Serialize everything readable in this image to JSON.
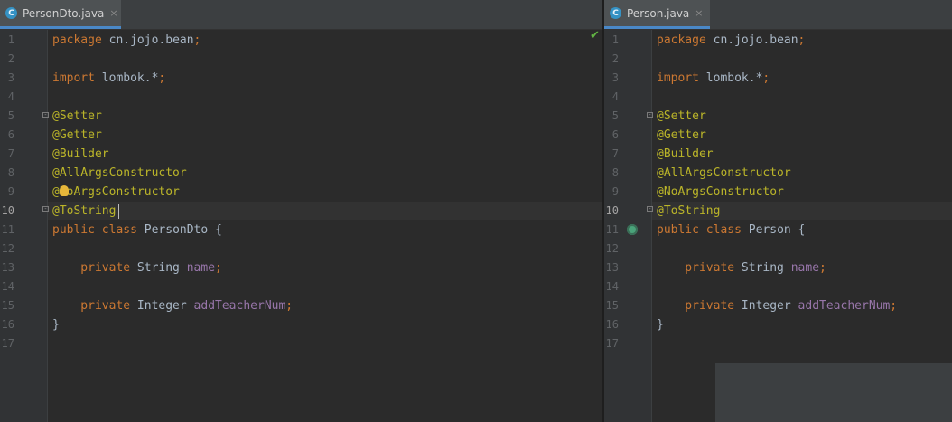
{
  "tabs": {
    "left": {
      "label": "PersonDto.java",
      "icon": "java-class-icon",
      "icon_letter": "C",
      "close": "×"
    },
    "right": {
      "label": "Person.java",
      "icon": "java-class-icon",
      "icon_letter": "C",
      "close": "×"
    }
  },
  "current_line": 10,
  "line_numbers": [
    "1",
    "2",
    "3",
    "4",
    "5",
    "6",
    "7",
    "8",
    "9",
    "10",
    "11",
    "12",
    "13",
    "14",
    "15",
    "16",
    "17"
  ],
  "left_file": {
    "name": "PersonDto.java",
    "lines": [
      [
        {
          "t": "package ",
          "c": "kw"
        },
        {
          "t": "cn.jojo.bean",
          "c": "pl"
        },
        {
          "t": ";",
          "c": "kw"
        }
      ],
      [],
      [
        {
          "t": "import ",
          "c": "kw"
        },
        {
          "t": "lombok.*",
          "c": "pl"
        },
        {
          "t": ";",
          "c": "kw"
        }
      ],
      [],
      [
        {
          "t": "@Setter",
          "c": "ann"
        }
      ],
      [
        {
          "t": "@Getter",
          "c": "ann"
        }
      ],
      [
        {
          "t": "@Builder",
          "c": "ann"
        }
      ],
      [
        {
          "t": "@AllArgsConstructor",
          "c": "ann"
        }
      ],
      [
        {
          "t": "@NoArgsConstructor",
          "c": "ann"
        }
      ],
      [
        {
          "t": "@ToString",
          "c": "ann"
        }
      ],
      [
        {
          "t": "public ",
          "c": "kw"
        },
        {
          "t": "class ",
          "c": "kw"
        },
        {
          "t": "PersonDto {",
          "c": "pl"
        }
      ],
      [],
      [
        {
          "t": "    private ",
          "c": "kw"
        },
        {
          "t": "String ",
          "c": "pl"
        },
        {
          "t": "name",
          "c": "fld"
        },
        {
          "t": ";",
          "c": "kw"
        }
      ],
      [],
      [
        {
          "t": "    private ",
          "c": "kw"
        },
        {
          "t": "Integer ",
          "c": "pl"
        },
        {
          "t": "addTeacherNum",
          "c": "fld"
        },
        {
          "t": ";",
          "c": "kw"
        }
      ],
      [
        {
          "t": "}",
          "c": "pl"
        }
      ],
      []
    ]
  },
  "right_file": {
    "name": "Person.java",
    "lines": [
      [
        {
          "t": "package ",
          "c": "kw"
        },
        {
          "t": "cn.jojo.bean",
          "c": "pl"
        },
        {
          "t": ";",
          "c": "kw"
        }
      ],
      [],
      [
        {
          "t": "import ",
          "c": "kw"
        },
        {
          "t": "lombok.*",
          "c": "pl"
        },
        {
          "t": ";",
          "c": "kw"
        }
      ],
      [],
      [
        {
          "t": "@Setter",
          "c": "ann"
        }
      ],
      [
        {
          "t": "@Getter",
          "c": "ann"
        }
      ],
      [
        {
          "t": "@Builder",
          "c": "ann"
        }
      ],
      [
        {
          "t": "@AllArgsConstructor",
          "c": "ann"
        }
      ],
      [
        {
          "t": "@NoArgsConstructor",
          "c": "ann"
        }
      ],
      [
        {
          "t": "@ToString",
          "c": "ann"
        }
      ],
      [
        {
          "t": "public ",
          "c": "kw"
        },
        {
          "t": "class ",
          "c": "kw"
        },
        {
          "t": "Person {",
          "c": "pl"
        }
      ],
      [],
      [
        {
          "t": "    private ",
          "c": "kw"
        },
        {
          "t": "String ",
          "c": "pl"
        },
        {
          "t": "name",
          "c": "fld"
        },
        {
          "t": ";",
          "c": "kw"
        }
      ],
      [],
      [
        {
          "t": "    private ",
          "c": "kw"
        },
        {
          "t": "Integer ",
          "c": "pl"
        },
        {
          "t": "addTeacherNum",
          "c": "fld"
        },
        {
          "t": ";",
          "c": "kw"
        }
      ],
      [
        {
          "t": "}",
          "c": "pl"
        }
      ],
      []
    ]
  },
  "icons": {
    "inspection": "check-icon",
    "intention": "bulb-icon",
    "gutter_marker": "implemented-icon"
  },
  "colors": {
    "background": "#2b2b2b",
    "keyword": "#cc7832",
    "annotation": "#bbb529",
    "field": "#9876aa",
    "plain": "#a9b7c6",
    "tab_accent": "#4a88c7"
  }
}
